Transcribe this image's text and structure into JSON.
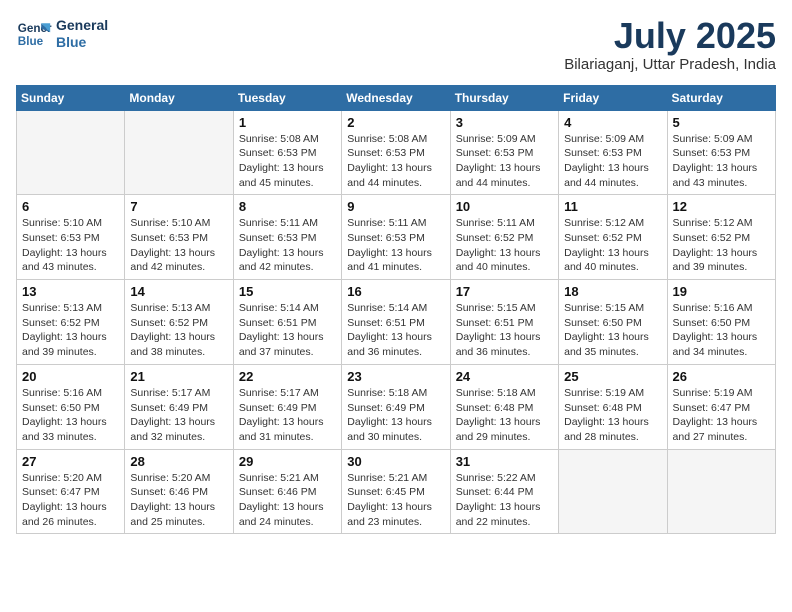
{
  "header": {
    "logo_line1": "General",
    "logo_line2": "Blue",
    "month_year": "July 2025",
    "location": "Bilariaganj, Uttar Pradesh, India"
  },
  "days_of_week": [
    "Sunday",
    "Monday",
    "Tuesday",
    "Wednesday",
    "Thursday",
    "Friday",
    "Saturday"
  ],
  "weeks": [
    [
      {
        "day": "",
        "info": ""
      },
      {
        "day": "",
        "info": ""
      },
      {
        "day": "1",
        "info": "Sunrise: 5:08 AM\nSunset: 6:53 PM\nDaylight: 13 hours and 45 minutes."
      },
      {
        "day": "2",
        "info": "Sunrise: 5:08 AM\nSunset: 6:53 PM\nDaylight: 13 hours and 44 minutes."
      },
      {
        "day": "3",
        "info": "Sunrise: 5:09 AM\nSunset: 6:53 PM\nDaylight: 13 hours and 44 minutes."
      },
      {
        "day": "4",
        "info": "Sunrise: 5:09 AM\nSunset: 6:53 PM\nDaylight: 13 hours and 44 minutes."
      },
      {
        "day": "5",
        "info": "Sunrise: 5:09 AM\nSunset: 6:53 PM\nDaylight: 13 hours and 43 minutes."
      }
    ],
    [
      {
        "day": "6",
        "info": "Sunrise: 5:10 AM\nSunset: 6:53 PM\nDaylight: 13 hours and 43 minutes."
      },
      {
        "day": "7",
        "info": "Sunrise: 5:10 AM\nSunset: 6:53 PM\nDaylight: 13 hours and 42 minutes."
      },
      {
        "day": "8",
        "info": "Sunrise: 5:11 AM\nSunset: 6:53 PM\nDaylight: 13 hours and 42 minutes."
      },
      {
        "day": "9",
        "info": "Sunrise: 5:11 AM\nSunset: 6:53 PM\nDaylight: 13 hours and 41 minutes."
      },
      {
        "day": "10",
        "info": "Sunrise: 5:11 AM\nSunset: 6:52 PM\nDaylight: 13 hours and 40 minutes."
      },
      {
        "day": "11",
        "info": "Sunrise: 5:12 AM\nSunset: 6:52 PM\nDaylight: 13 hours and 40 minutes."
      },
      {
        "day": "12",
        "info": "Sunrise: 5:12 AM\nSunset: 6:52 PM\nDaylight: 13 hours and 39 minutes."
      }
    ],
    [
      {
        "day": "13",
        "info": "Sunrise: 5:13 AM\nSunset: 6:52 PM\nDaylight: 13 hours and 39 minutes."
      },
      {
        "day": "14",
        "info": "Sunrise: 5:13 AM\nSunset: 6:52 PM\nDaylight: 13 hours and 38 minutes."
      },
      {
        "day": "15",
        "info": "Sunrise: 5:14 AM\nSunset: 6:51 PM\nDaylight: 13 hours and 37 minutes."
      },
      {
        "day": "16",
        "info": "Sunrise: 5:14 AM\nSunset: 6:51 PM\nDaylight: 13 hours and 36 minutes."
      },
      {
        "day": "17",
        "info": "Sunrise: 5:15 AM\nSunset: 6:51 PM\nDaylight: 13 hours and 36 minutes."
      },
      {
        "day": "18",
        "info": "Sunrise: 5:15 AM\nSunset: 6:50 PM\nDaylight: 13 hours and 35 minutes."
      },
      {
        "day": "19",
        "info": "Sunrise: 5:16 AM\nSunset: 6:50 PM\nDaylight: 13 hours and 34 minutes."
      }
    ],
    [
      {
        "day": "20",
        "info": "Sunrise: 5:16 AM\nSunset: 6:50 PM\nDaylight: 13 hours and 33 minutes."
      },
      {
        "day": "21",
        "info": "Sunrise: 5:17 AM\nSunset: 6:49 PM\nDaylight: 13 hours and 32 minutes."
      },
      {
        "day": "22",
        "info": "Sunrise: 5:17 AM\nSunset: 6:49 PM\nDaylight: 13 hours and 31 minutes."
      },
      {
        "day": "23",
        "info": "Sunrise: 5:18 AM\nSunset: 6:49 PM\nDaylight: 13 hours and 30 minutes."
      },
      {
        "day": "24",
        "info": "Sunrise: 5:18 AM\nSunset: 6:48 PM\nDaylight: 13 hours and 29 minutes."
      },
      {
        "day": "25",
        "info": "Sunrise: 5:19 AM\nSunset: 6:48 PM\nDaylight: 13 hours and 28 minutes."
      },
      {
        "day": "26",
        "info": "Sunrise: 5:19 AM\nSunset: 6:47 PM\nDaylight: 13 hours and 27 minutes."
      }
    ],
    [
      {
        "day": "27",
        "info": "Sunrise: 5:20 AM\nSunset: 6:47 PM\nDaylight: 13 hours and 26 minutes."
      },
      {
        "day": "28",
        "info": "Sunrise: 5:20 AM\nSunset: 6:46 PM\nDaylight: 13 hours and 25 minutes."
      },
      {
        "day": "29",
        "info": "Sunrise: 5:21 AM\nSunset: 6:46 PM\nDaylight: 13 hours and 24 minutes."
      },
      {
        "day": "30",
        "info": "Sunrise: 5:21 AM\nSunset: 6:45 PM\nDaylight: 13 hours and 23 minutes."
      },
      {
        "day": "31",
        "info": "Sunrise: 5:22 AM\nSunset: 6:44 PM\nDaylight: 13 hours and 22 minutes."
      },
      {
        "day": "",
        "info": ""
      },
      {
        "day": "",
        "info": ""
      }
    ]
  ]
}
